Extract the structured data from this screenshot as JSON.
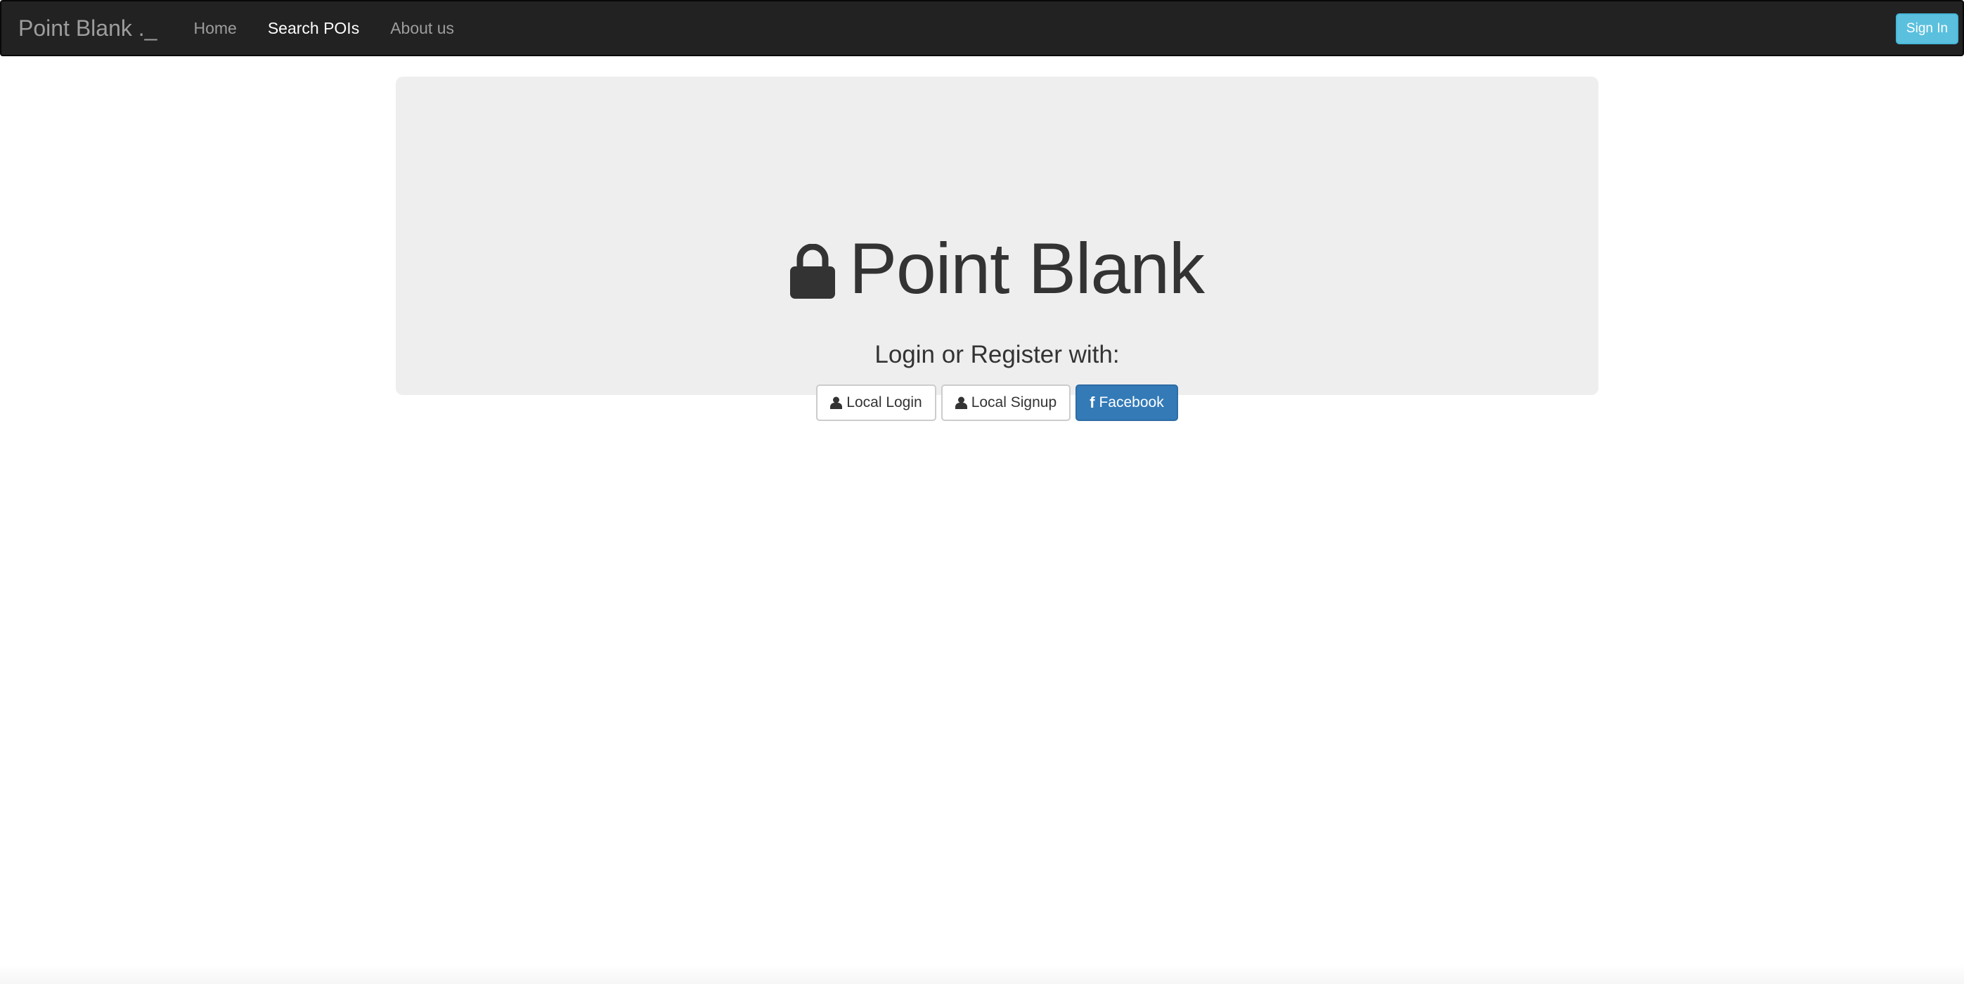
{
  "navbar": {
    "brand": "Point Blank ._",
    "items": [
      {
        "label": "Home",
        "active": false
      },
      {
        "label": "Search POIs",
        "active": true
      },
      {
        "label": "About us",
        "active": false
      }
    ],
    "signin_label": "Sign In"
  },
  "hero": {
    "icon": "lock-icon",
    "title": "Point Blank",
    "subtitle": "Login or Register with:",
    "buttons": [
      {
        "label": "Local Login",
        "icon": "user-icon"
      },
      {
        "label": "Local Signup",
        "icon": "user-icon"
      },
      {
        "label": "Facebook",
        "icon": "facebook-icon"
      }
    ]
  },
  "colors": {
    "navbar_bg": "#222222",
    "jumbotron_bg": "#eeeeee",
    "signin_bg": "#5bc0de",
    "facebook_bg": "#337ab7",
    "text_dark": "#333333"
  }
}
